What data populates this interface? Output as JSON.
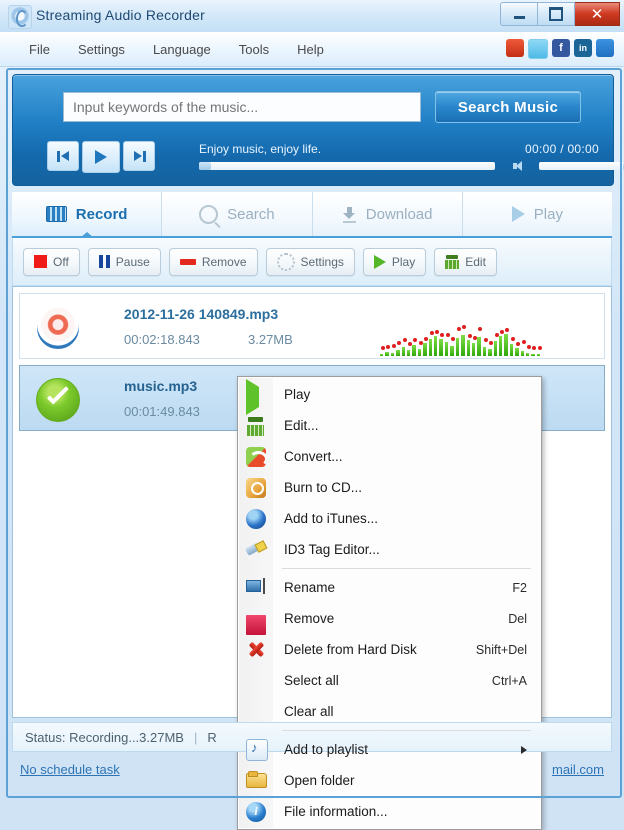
{
  "window": {
    "title": "Streaming Audio Recorder",
    "logo_icon": "app-logo-icon",
    "minimize_label": "",
    "maximize_label": "",
    "close_label": "✕"
  },
  "menubar": {
    "items": [
      {
        "label": "File"
      },
      {
        "label": "Settings"
      },
      {
        "label": "Language"
      },
      {
        "label": "Tools"
      },
      {
        "label": "Help"
      }
    ],
    "socials": [
      {
        "name": "googleplus-icon",
        "glyph": "g+"
      },
      {
        "name": "twitter-icon",
        "glyph": "t"
      },
      {
        "name": "facebook-icon",
        "glyph": "f"
      },
      {
        "name": "linkedin-icon",
        "glyph": "in"
      },
      {
        "name": "share-icon",
        "glyph": "➦"
      }
    ]
  },
  "search": {
    "placeholder": "Input keywords of the music...",
    "value": "",
    "button_label": "Search Music"
  },
  "player": {
    "prev_icon": "previous-track-icon",
    "play_icon": "play-icon",
    "next_icon": "next-track-icon",
    "tagline": "Enjoy music, enjoy life.",
    "time": "00:00 / 00:00",
    "seek_percent": 0,
    "volume_percent": 100
  },
  "tabs": [
    {
      "label": "Record",
      "icon": "record-grid-icon",
      "active": true
    },
    {
      "label": "Search",
      "icon": "search-icon",
      "active": false
    },
    {
      "label": "Download",
      "icon": "download-icon",
      "active": false
    },
    {
      "label": "Play",
      "icon": "play-icon",
      "active": false
    }
  ],
  "toolbar": [
    {
      "label": "Off",
      "icon": "stop-square-icon"
    },
    {
      "label": "Pause",
      "icon": "pause-icon"
    },
    {
      "label": "Remove",
      "icon": "remove-minus-icon"
    },
    {
      "label": "Settings",
      "icon": "gear-icon"
    },
    {
      "label": "Play",
      "icon": "play-icon"
    },
    {
      "label": "Edit",
      "icon": "equalizer-edit-icon"
    }
  ],
  "list": {
    "rows": [
      {
        "icon": "recording-indicator-icon",
        "title": "2012-11-26 140849.mp3",
        "duration": "00:02:18.843",
        "size": "3.27MB",
        "selected": false,
        "spectrum": [
          3,
          5,
          4,
          8,
          11,
          7,
          14,
          9,
          17,
          22,
          26,
          21,
          18,
          13,
          23,
          27,
          20,
          16,
          24,
          12,
          9,
          19,
          25,
          28,
          15,
          10,
          6,
          4,
          3,
          3
        ]
      },
      {
        "icon": "completed-check-icon",
        "title": "music.mp3",
        "duration": "00:01:49.843",
        "size": "",
        "selected": true,
        "spectrum": []
      }
    ]
  },
  "context_menu": {
    "groups": [
      [
        {
          "label": "Play",
          "shortcut": "",
          "icon": "play-icon",
          "submenu": false
        },
        {
          "label": "Edit...",
          "shortcut": "",
          "icon": "equalizer-edit-icon",
          "submenu": false
        },
        {
          "label": "Convert...",
          "shortcut": "",
          "icon": "convert-icon",
          "submenu": false
        },
        {
          "label": "Burn to CD...",
          "shortcut": "",
          "icon": "burn-cd-icon",
          "submenu": false
        },
        {
          "label": "Add to iTunes...",
          "shortcut": "",
          "icon": "itunes-icon",
          "submenu": false
        },
        {
          "label": "ID3 Tag Editor...",
          "shortcut": "",
          "icon": "id3-tag-icon",
          "submenu": false
        }
      ],
      [
        {
          "label": "Rename",
          "shortcut": "F2",
          "icon": "rename-icon",
          "submenu": false
        },
        {
          "label": "Remove",
          "shortcut": "Del",
          "icon": "remove-minus-icon",
          "submenu": false
        },
        {
          "label": "Delete from Hard Disk",
          "shortcut": "Shift+Del",
          "icon": "delete-x-icon",
          "submenu": false
        },
        {
          "label": "Select all",
          "shortcut": "Ctrl+A",
          "icon": "",
          "submenu": false
        },
        {
          "label": "Clear all",
          "shortcut": "",
          "icon": "",
          "submenu": false
        }
      ],
      [
        {
          "label": "Add to playlist",
          "shortcut": "",
          "icon": "playlist-icon",
          "submenu": true
        },
        {
          "label": "Open folder",
          "shortcut": "",
          "icon": "folder-icon",
          "submenu": false
        },
        {
          "label": "File information...",
          "shortcut": "",
          "icon": "info-icon",
          "submenu": false
        }
      ]
    ]
  },
  "statusbar": {
    "text": "Status: Recording...3.27MB",
    "separator": "|",
    "text2": "R"
  },
  "footer": {
    "schedule_link": "No schedule task",
    "email_link": "mail.com"
  },
  "colors": {
    "accent_blue": "#2180c6",
    "tab_active": "#1c6fae",
    "record_red": "#ef1b17",
    "success_green": "#7cc92b",
    "close_red": "#cf3a22"
  }
}
